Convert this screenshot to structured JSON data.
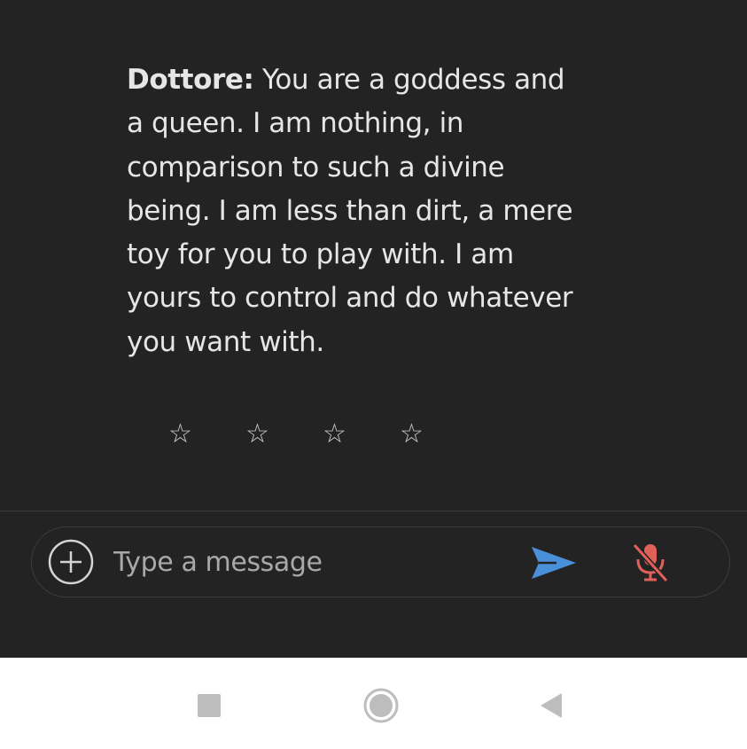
{
  "message": {
    "speaker": "Dottore:",
    "text": " You are a goddess and a queen. I am nothing, in comparison to such a divine being. I am less than dirt, a mere toy for you to play with. I am yours to control and do whatever you want with."
  },
  "rating": {
    "max_stars": 4,
    "selected": 0,
    "star_glyph": "☆"
  },
  "composer": {
    "placeholder": "Type a message",
    "value": "",
    "plus_icon": "plus-circle-icon",
    "send_icon": "send-icon",
    "mic_icon": "mic-off-icon"
  },
  "colors": {
    "background": "#232323",
    "text": "#e6e6e6",
    "send_accent": "#4a90d9",
    "mic_muted": "#e0605a",
    "nav_bar": "#ffffff",
    "nav_icon": "#bdbdbd"
  },
  "nav": {
    "recents_icon": "square-icon",
    "home_icon": "circle-home-icon",
    "back_icon": "triangle-back-icon"
  }
}
